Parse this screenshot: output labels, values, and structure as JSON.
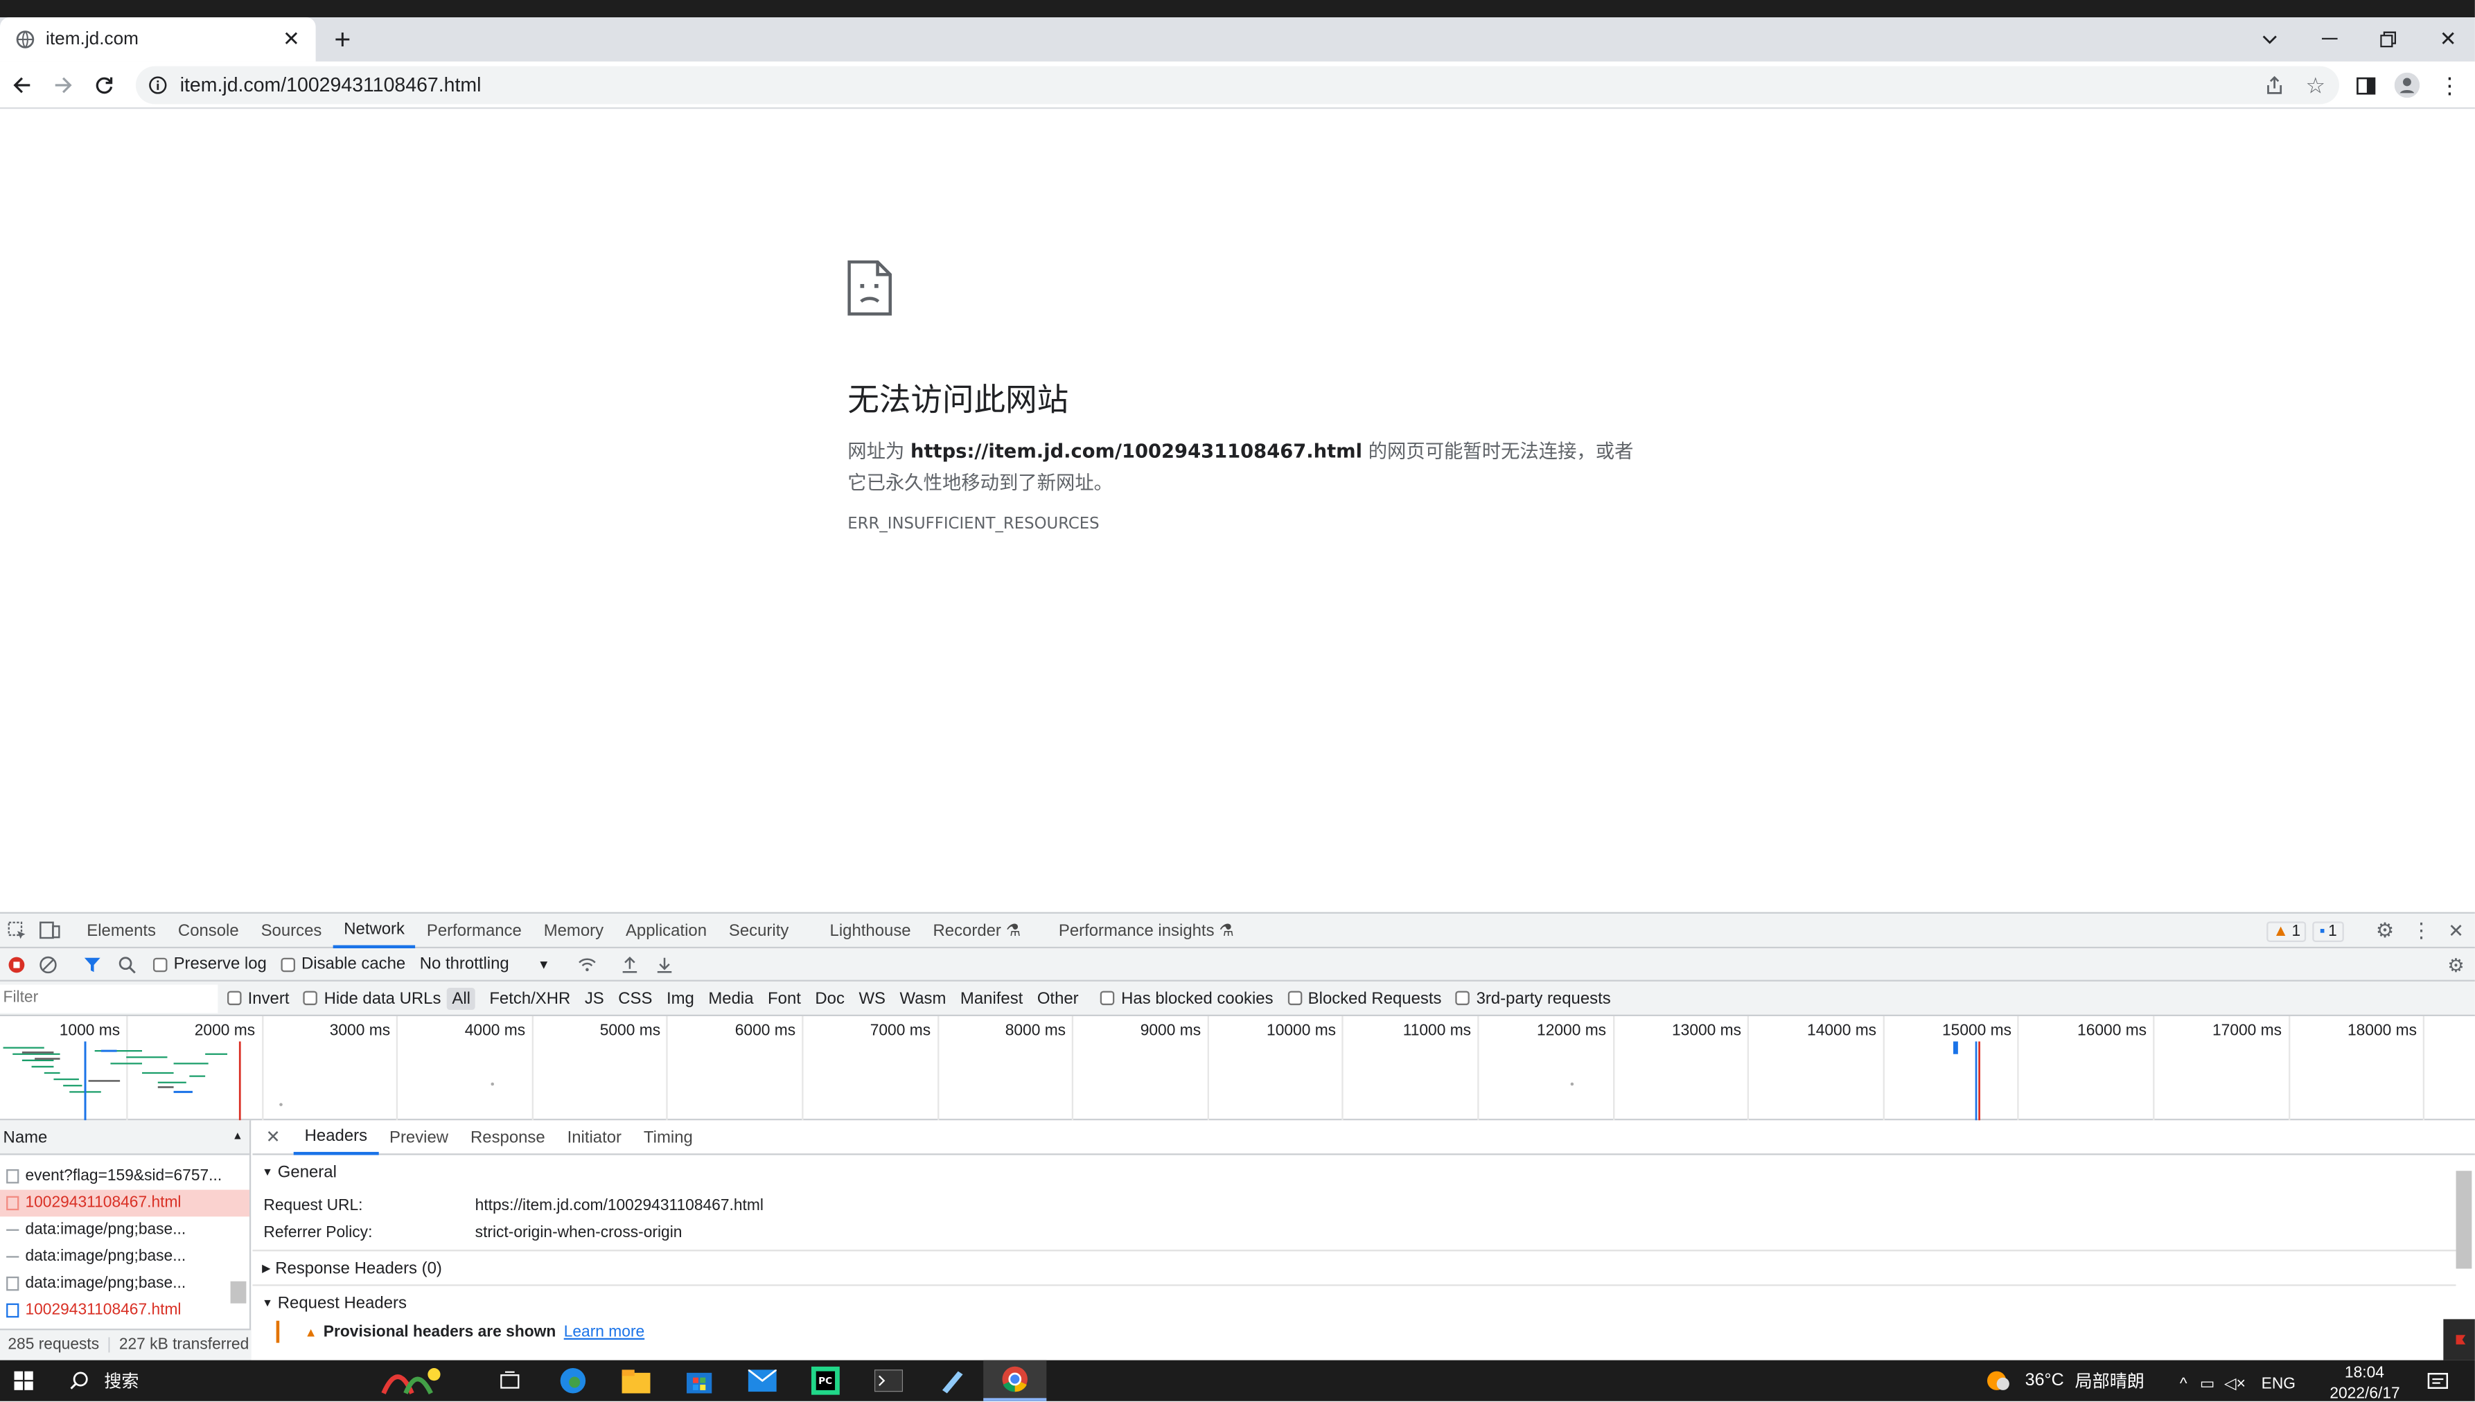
{
  "browser": {
    "tab_title": "item.jd.com",
    "new_tab": "+",
    "url": "item.jd.com/10029431108467.html"
  },
  "error_page": {
    "title": "无法访问此网站",
    "body_prefix": "网址为 ",
    "body_url": "https://item.jd.com/10029431108467.html",
    "body_suffix": " 的网页可能暂时无法连接，或者它已永久性地移动到了新网址。",
    "code": "ERR_INSUFFICIENT_RESOURCES"
  },
  "devtools": {
    "tabs": [
      "Elements",
      "Console",
      "Sources",
      "Network",
      "Performance",
      "Memory",
      "Application",
      "Security",
      "Lighthouse",
      "Recorder",
      "Performance insights"
    ],
    "active_tab": "Network",
    "warnings": "1",
    "messages": "1",
    "toolbar": {
      "preserve_log": "Preserve log",
      "disable_cache": "Disable cache",
      "throttling": "No throttling"
    },
    "filter": {
      "placeholder": "Filter",
      "invert": "Invert",
      "hide_data_urls": "Hide data URLs",
      "types": [
        "All",
        "Fetch/XHR",
        "JS",
        "CSS",
        "Img",
        "Media",
        "Font",
        "Doc",
        "WS",
        "Wasm",
        "Manifest",
        "Other"
      ],
      "has_blocked_cookies": "Has blocked cookies",
      "blocked_requests": "Blocked Requests",
      "third_party": "3rd-party requests"
    },
    "timeline_ticks": [
      "1000 ms",
      "2000 ms",
      "3000 ms",
      "4000 ms",
      "5000 ms",
      "6000 ms",
      "7000 ms",
      "8000 ms",
      "9000 ms",
      "10000 ms",
      "11000 ms",
      "12000 ms",
      "13000 ms",
      "14000 ms",
      "15000 ms",
      "16000 ms",
      "17000 ms",
      "18000 ms"
    ],
    "request_list": {
      "header": "Name",
      "rows": [
        {
          "name": "event?flag=159&sid=6757...",
          "status": "normal"
        },
        {
          "name": "10029431108467.html",
          "status": "error-selected"
        },
        {
          "name": "data:image/png;base...",
          "status": "normal"
        },
        {
          "name": "data:image/png;base...",
          "status": "normal"
        },
        {
          "name": "data:image/png;base...",
          "status": "normal"
        },
        {
          "name": "10029431108467.html",
          "status": "error"
        }
      ],
      "requests": "285 requests",
      "transferred": "227 kB transferred"
    },
    "detail": {
      "tabs": [
        "Headers",
        "Preview",
        "Response",
        "Initiator",
        "Timing"
      ],
      "general": "General",
      "request_url_label": "Request URL:",
      "request_url": "https://item.jd.com/10029431108467.html",
      "referrer_label": "Referrer Policy:",
      "referrer": "strict-origin-when-cross-origin",
      "response_headers": "Response Headers (0)",
      "request_headers": "Request Headers",
      "provisional": "Provisional headers are shown",
      "learn_more": "Learn more"
    }
  },
  "taskbar": {
    "search": "搜索",
    "weather": "36°C",
    "weather_desc": "局部晴朗",
    "lang": "ENG",
    "time": "18:04",
    "date": "2022/6/17"
  }
}
